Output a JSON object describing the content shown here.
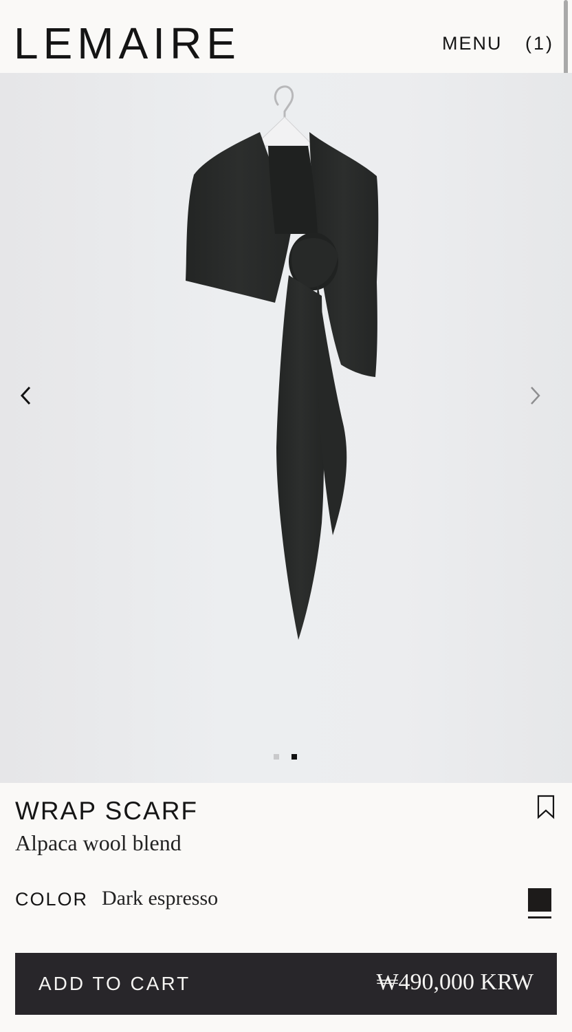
{
  "header": {
    "logo": "LEMAIRE",
    "menu_label": "MENU",
    "cart_count": "(1)"
  },
  "gallery": {
    "image_alt": "Wrap scarf on hanger",
    "prev_icon": "chevron-left-icon",
    "next_icon": "chevron-right-icon",
    "current_slide": 2,
    "total_slides": 2
  },
  "product": {
    "name": "WRAP SCARF",
    "material": "Alpaca wool blend",
    "color_label": "COLOR",
    "color_value": "Dark espresso",
    "swatch_color": "#1d1b1a",
    "price": "₩490,000 KRW",
    "add_to_cart_label": "ADD TO CART",
    "bookmark_icon": "bookmark-icon"
  },
  "colors": {
    "background": "#faf9f7",
    "button": "#28262a",
    "text": "#151515"
  }
}
